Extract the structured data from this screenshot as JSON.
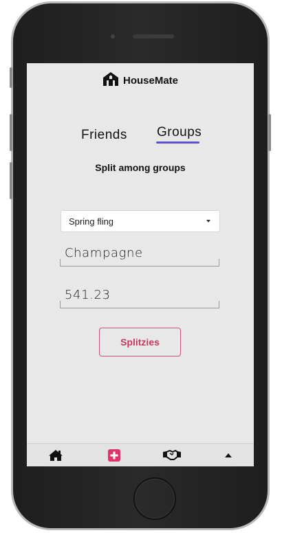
{
  "app": {
    "name": "HouseMate"
  },
  "tabs": [
    {
      "label": "Friends",
      "active": false
    },
    {
      "label": "Groups",
      "active": true
    }
  ],
  "subtitle": "Split among groups",
  "group_select": {
    "selected": "Spring fling"
  },
  "form": {
    "item_value": "Champagne",
    "amount_value": "541.23",
    "submit_label": "Splitzies"
  },
  "bottom_nav": {
    "items": [
      {
        "icon": "home-icon"
      },
      {
        "icon": "add-icon",
        "active": true
      },
      {
        "icon": "handshake-icon"
      },
      {
        "icon": "caret-up-icon"
      }
    ]
  },
  "colors": {
    "accent": "#5b4fd6",
    "button": "#c8385f",
    "add_icon": "#e0336a",
    "screen_bg": "#e8e8e8"
  }
}
